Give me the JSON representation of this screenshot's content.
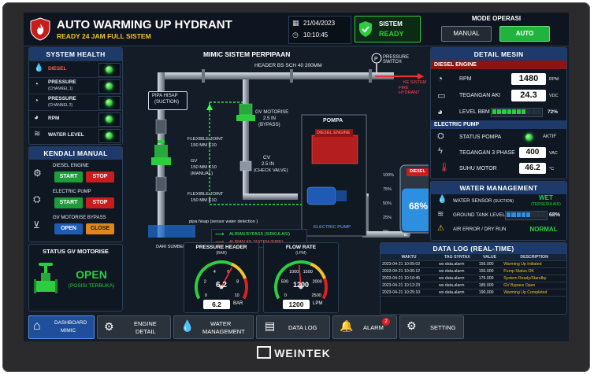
{
  "header": {
    "title": "AUTO WARMING UP HYDRANT",
    "subtitle": "READY 24 JAM FULL SISTEM",
    "date": "21/04/2023",
    "time": "10:10:45",
    "system_label": "SISTEM",
    "system_status": "READY",
    "mode_title": "MODE OPERASI",
    "mode_manual": "MANUAL",
    "mode_auto": "AUTO"
  },
  "system_health": {
    "title": "SYSTEM HEALTH",
    "items": [
      {
        "label": "DIESEL",
        "sub": "",
        "icon": "droplet-icon"
      },
      {
        "label": "PRESSURE",
        "sub": "(CHANNEL 1)",
        "icon": "gauge-icon"
      },
      {
        "label": "PRESSURE",
        "sub": "(CHANNEL 2)",
        "icon": "gauge-icon"
      },
      {
        "label": "RPM",
        "sub": "",
        "icon": "tachometer-icon"
      },
      {
        "label": "WATER LEVEL",
        "sub": "",
        "icon": "wave-icon"
      }
    ]
  },
  "manual_control": {
    "title": "KENDALI MANUAL",
    "diesel_label": "DIESEL ENGINE",
    "pump_label": "ELECTRIC PUMP",
    "bypass_label": "GV MOTORISE BYPASS",
    "start": "START",
    "stop": "STOP",
    "open": "OPEN",
    "close": "CLOSE"
  },
  "gv_status": {
    "title": "STATUS GV MOTORISE",
    "value": "OPEN",
    "sub": "(POSISI TERBUKA)"
  },
  "mimic": {
    "title": "MIMIC SISTEM PERPIPAAN",
    "header_pipe": "HEADER BS SCH 40 200MM",
    "pressure_switch": "PRESSURE SWITCH",
    "to_hydrant_1": "KE SISTEM",
    "to_hydrant_2": "FIRE HYDRANT",
    "suction_1": "PIPA HISAP",
    "suction_2": "(SUCTION)",
    "gv_bypass_1": "GV MOTORISE",
    "gv_bypass_2": "2.5 IN",
    "gv_bypass_3": "(BYPASS)",
    "fj_top_1": "FLEXIBLE JOINT",
    "fj_top_2": "150 MM K10",
    "gv_manual_1": "GV",
    "gv_manual_2": "150 MM K10",
    "gv_manual_3": "(MANUAL)",
    "cv_1": "CV",
    "cv_2": "2.5 IN",
    "cv_3": "(CHECK VALVE)",
    "fj_bot_1": "FLEXIBLE JOINT",
    "fj_bot_2": "150 MM K10",
    "pompa": "POMPA",
    "diesel_engine": "DIESEL ENGINE",
    "electric_pump": "ELECTRIC PUMP",
    "pipe_sensor": "pipa hisap (sensor water detection )",
    "legend_bypass": "ALIRAN BYPASS (SIRKULASI)",
    "legend_fire": "ALIRAN KE SISTEM (FIRE)",
    "source": "DARI SUMBER AIR",
    "tank_label": "DIESEL",
    "tank_level": "68%",
    "tank_ticks": [
      "100%",
      "75%",
      "50%",
      "25%",
      "0%"
    ]
  },
  "gauges": {
    "pressure": {
      "title": "PRESSURE HEADER",
      "unit_top": "(BAR)",
      "value": "6.2",
      "readout": "6.2",
      "unit": "BAR",
      "ticks": [
        "0",
        "2",
        "4",
        "6",
        "8",
        "10"
      ]
    },
    "flow": {
      "title": "FLOW RATE",
      "unit_top": "(LPM)",
      "value": "1200",
      "readout": "1200",
      "unit": "LPM",
      "ticks": [
        "0",
        "500",
        "1000",
        "1500",
        "2000",
        "2500"
      ]
    }
  },
  "detail": {
    "title": "DETAIL MESIN",
    "diesel_section": "DIESEL ENGINE",
    "rpm_label": "RPM",
    "rpm_value": "1480",
    "rpm_unit": "RPM",
    "aki_label": "TEGANGAN AKI",
    "aki_value": "24.3",
    "aki_unit": "VDC",
    "bbm_label": "LEVEL BBM",
    "bbm_value": "72%",
    "bbm_fraction": 0.72,
    "pump_section": "ELECTRIC PUMP",
    "status_label": "STATUS POMPA",
    "status_value": "AKTIF",
    "volt_label": "TEGANGAN 3 PHASE",
    "volt_value": "400",
    "volt_unit": "VAC",
    "temp_label": "SUHU MOTOR",
    "temp_value": "46.2",
    "temp_unit": "°C"
  },
  "water": {
    "title": "WATER MANAGEMENT",
    "sensor_label": "WATER SENSOR",
    "sensor_sub": "(SUCTION)",
    "sensor_value": "WET",
    "sensor_value_sub": "(TERSEDIA AIR)",
    "tank_label": "GROUND TANK LEVEL",
    "tank_value": "68%",
    "tank_fraction": 0.68,
    "error_label": "AIR ERROR / DRY RUN",
    "error_value": "NORMAL"
  },
  "datalog": {
    "title": "DATA LOG (REAL-TIME)",
    "columns": [
      "WAKTU",
      "TAG SYNTAX",
      "VALUE",
      "DESCRIPTION"
    ],
    "rows": [
      [
        "2023-04-21 10:05:02",
        "ws data.alarm",
        "156.000",
        "Warming Up Initiated"
      ],
      [
        "2023-04-21 10:06:12",
        "ws data.alarm",
        "155.000",
        "Pump Status OK"
      ],
      [
        "2023-04-21 10:10:45",
        "ws data.alarm",
        "176.000",
        "System Ready/Standby"
      ],
      [
        "2023-04-21 10:12:23",
        "ws data.alarm",
        "185.000",
        "GV Bypass Open"
      ],
      [
        "2023-04-21 10:25:10",
        "ws data.alarm",
        "190.000",
        "Warming Up Completed"
      ]
    ]
  },
  "nav": {
    "dashboard_1": "DASHBOARD",
    "dashboard_2": "MIMIC",
    "engine_1": "ENGINE",
    "engine_2": "DETAIL",
    "water_1": "WATER",
    "water_2": "MANAGEMENT",
    "datalog": "DATA LOG",
    "alarm": "ALARM",
    "alarm_badge": "2",
    "setting": "SETTING"
  },
  "brand": "WEINTEK",
  "colors": {
    "accent_green": "#1e9b3a",
    "accent_red": "#c81d1d",
    "accent_blue": "#1f5bb5",
    "panel_header": "#1d3a6a"
  }
}
